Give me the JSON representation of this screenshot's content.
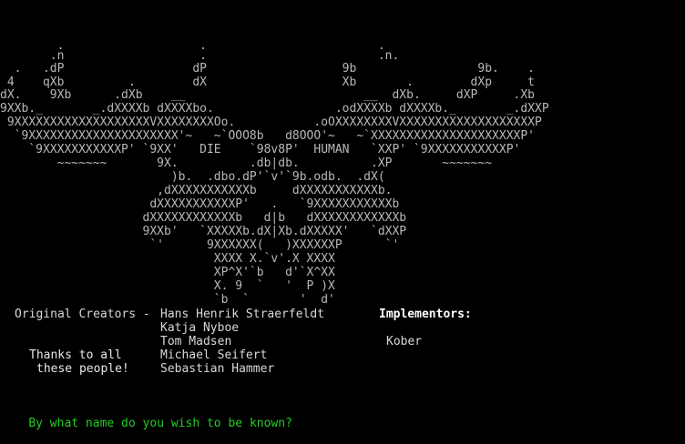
{
  "art": {
    "lines": [
      "        .                   .                        .",
      "       .n                   .                        .n.",
      "  .   .dP                  dP                   9b                 9b.    .",
      " 4    qXb         .        dX                   Xb       .        dXp     t",
      "dX.    9Xb      .dXb    __                         __  dXb.     dXP     .Xb",
      "9XXb._       _.dXXXXb dXXXXbo.                 .odXXXXb dXXXXb._       _.dXXP",
      " 9XXXXXXXXXXXXXXXXXXXVXXXXXXXXOo.           .oOXXXXXXXXVXXXXXXXXXXXXXXXXXXXP",
      "  `9XXXXXXXXXXXXXXXXXXXXX'~   ~`OOO8b   d8OOO'~   ~`XXXXXXXXXXXXXXXXXXXXXP'",
      "    `9XXXXXXXXXXXP' `9XX'   DIE    `98v8P'  HUMAN   `XXP' `9XXXXXXXXXXXP'",
      "        ~~~~~~~       9X.          .db|db.          .XP       ~~~~~~~",
      "                        )b.  .dbo.dP'`v'`9b.odb.  .dX(",
      "                      ,dXXXXXXXXXXXb     dXXXXXXXXXXXb.",
      "                     dXXXXXXXXXXXP'   .   `9XXXXXXXXXXXb",
      "                    dXXXXXXXXXXXXb   d|b   dXXXXXXXXXXXXb",
      "                    9XXb'   `XXXXXb.dX|Xb.dXXXXX'   `dXXP",
      "                     `'      9XXXXXX(   )XXXXXXP      `'",
      "                              XXXX X.`v'.X XXXX",
      "                              XP^X'`b   d'`X^XX",
      "                              X. 9  `   '  P )X",
      "                              `b  `       '  d'"
    ]
  },
  "credits": {
    "original_label": "Original Creators - ",
    "creators": [
      "Hans Henrik Straerfeldt",
      "Katja Nyboe",
      "Tom Madsen",
      "Michael Seifert",
      "Sebastian Hammer"
    ],
    "implementors_label": "Implementors:",
    "implementors": [
      "Kober"
    ],
    "thanks_line1": "Thanks to all",
    "thanks_line2": "these people!"
  },
  "prompt": {
    "text": "By what name do you wish to be known?"
  },
  "colors": {
    "background": "#000000",
    "text": "#c0c0c0",
    "accent_red": "#a00000",
    "prompt_green": "#22cc22"
  }
}
